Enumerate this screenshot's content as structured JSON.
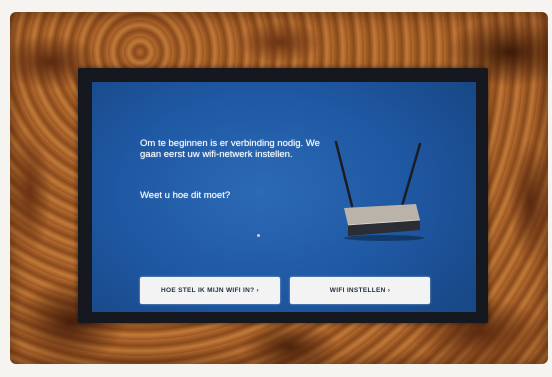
{
  "setup": {
    "message": "Om te beginnen is er verbinding nodig. We gaan eerst uw wifi-netwerk instellen.",
    "question": "Weet u hoe dit moet?",
    "buttons": {
      "help_label": "HOE STEL IK MIJN WIFI IN? ›",
      "setup_label": "WIFI INSTELLEN ›"
    }
  },
  "colors": {
    "screen_blue": "#2c6ab6",
    "button_bg": "#f3f3f3",
    "frame_wood": "#a35f28"
  },
  "icons": {
    "illustration": "wifi-router-icon"
  }
}
